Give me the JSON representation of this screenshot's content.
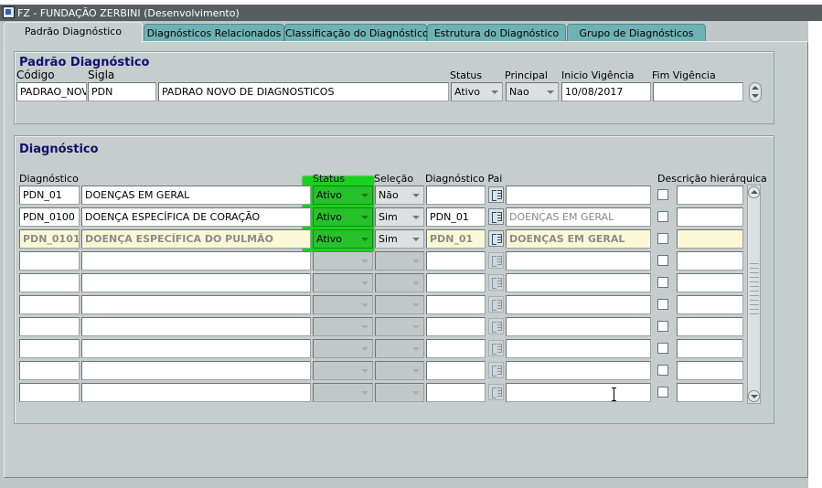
{
  "window": {
    "title": "FZ - FUNDAÇÃO ZERBINI (Desenvolvimento)"
  },
  "tabs": [
    "Padrão Diagnóstico",
    "Diagnósticos Relacionados",
    "Classificação do Diagnóstico",
    "Estrutura do Diagnóstico",
    "Grupo de Diagnósticos"
  ],
  "header_block": {
    "title": "Padrão Diagnóstico",
    "labels": {
      "codigo": "Código",
      "sigla": "Sigla",
      "status": "Status",
      "principal": "Principal",
      "inicio": "Inicio Vigência",
      "fim": "Fim Vigência"
    },
    "values": {
      "codigo": "PADRAO_NOV",
      "sigla": "PDN",
      "descricao": "PADRAO NOVO DE DIAGNOSTICOS",
      "status": "Ativo",
      "principal": "Nao",
      "inicio": "10/08/2017",
      "fim": ""
    }
  },
  "detail_block": {
    "title": "Diagnóstico",
    "columns": {
      "diagnostico": "Diagnóstico",
      "status": "Status",
      "selecao": "Seleção",
      "pai": "Diagnóstico Pai",
      "hier": "Descrição hierárquica"
    },
    "rows": [
      {
        "code": "PDN_01",
        "desc": "DOENÇAS EM GERAL",
        "status": "Ativo",
        "selecao": "Não",
        "pai": "",
        "pai_desc": ""
      },
      {
        "code": "PDN_0100",
        "desc": "DOENÇA ESPECÍFICA DE CORAÇÃO",
        "status": "Ativo",
        "selecao": "Sim",
        "pai": "PDN_01",
        "pai_desc": "DOENÇAS EM GERAL"
      },
      {
        "code": "PDN_0101",
        "desc": "DOENÇA ESPECÍFICA DO PULMÃO",
        "status": "Ativo",
        "selecao": "Sim",
        "pai": "PDN_01",
        "pai_desc": "DOENÇAS EM GERAL"
      },
      {
        "code": "",
        "desc": "",
        "status": "",
        "selecao": "",
        "pai": "",
        "pai_desc": ""
      },
      {
        "code": "",
        "desc": "",
        "status": "",
        "selecao": "",
        "pai": "",
        "pai_desc": ""
      },
      {
        "code": "",
        "desc": "",
        "status": "",
        "selecao": "",
        "pai": "",
        "pai_desc": ""
      },
      {
        "code": "",
        "desc": "",
        "status": "",
        "selecao": "",
        "pai": "",
        "pai_desc": ""
      },
      {
        "code": "",
        "desc": "",
        "status": "",
        "selecao": "",
        "pai": "",
        "pai_desc": ""
      },
      {
        "code": "",
        "desc": "",
        "status": "",
        "selecao": "",
        "pai": "",
        "pai_desc": ""
      },
      {
        "code": "",
        "desc": "",
        "status": "",
        "selecao": "",
        "pai": "",
        "pai_desc": ""
      }
    ]
  },
  "colors": {
    "tab": "#6fb2b5",
    "panel": "#c6cdcd",
    "title_blue": "#10106e",
    "status_highlight": "#17d31b",
    "current_row": "#fbf8d6"
  },
  "icons": [
    "app-icon",
    "lov-list-icon",
    "scroll-up-icon",
    "scroll-down-icon",
    "text-cursor-icon"
  ]
}
